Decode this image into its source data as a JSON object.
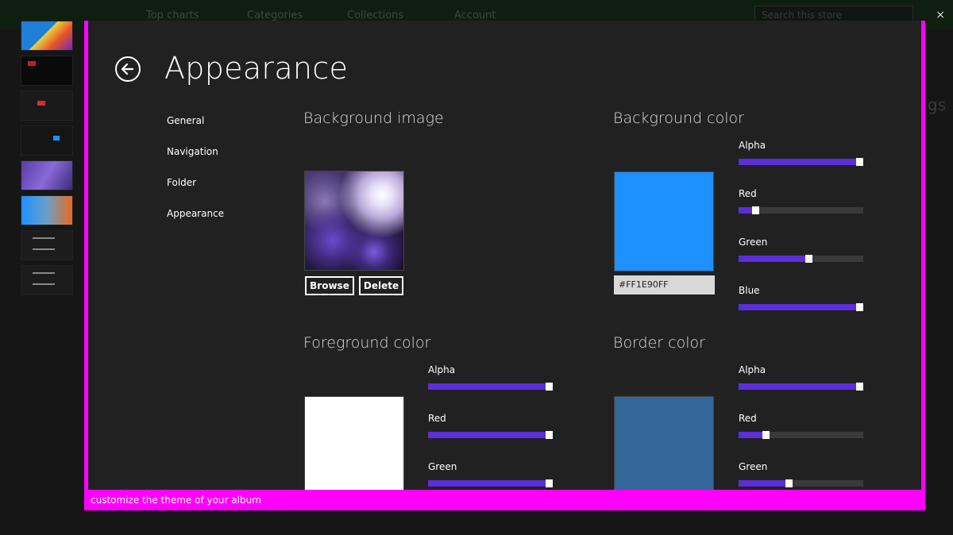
{
  "background_app": {
    "nav": [
      "Top charts",
      "Categories",
      "Collections",
      "Account"
    ],
    "search_placeholder": "Search this store",
    "close_glyph": "×",
    "right_partial_text": "gs"
  },
  "dialog": {
    "title": "Appearance",
    "status_text": "customize the theme of your album",
    "nav": [
      "General",
      "Navigation",
      "Folder",
      "Appearance"
    ],
    "background_image": {
      "title": "Background image",
      "browse_label": "Browse",
      "delete_label": "Delete"
    },
    "background_color": {
      "title": "Background color",
      "hex": "#FF1E90FF",
      "swatch_color": "#1E90FF",
      "sliders": [
        {
          "label": "Alpha",
          "value": 255
        },
        {
          "label": "Red",
          "value": 30
        },
        {
          "label": "Green",
          "value": 144
        },
        {
          "label": "Blue",
          "value": 255
        }
      ]
    },
    "foreground_color": {
      "title": "Foreground color",
      "swatch_color": "#FFFFFF",
      "sliders": [
        {
          "label": "Alpha",
          "value": 255
        },
        {
          "label": "Red",
          "value": 255
        },
        {
          "label": "Green",
          "value": 255
        }
      ]
    },
    "border_color": {
      "title": "Border color",
      "swatch_color": "#336699",
      "sliders": [
        {
          "label": "Alpha",
          "value": 255
        },
        {
          "label": "Red",
          "value": 51
        },
        {
          "label": "Green",
          "value": 102
        }
      ]
    }
  },
  "colors": {
    "accent": "#5B2FD8",
    "dialog_border": "#FF00FF",
    "dialog_bg": "#212121"
  }
}
